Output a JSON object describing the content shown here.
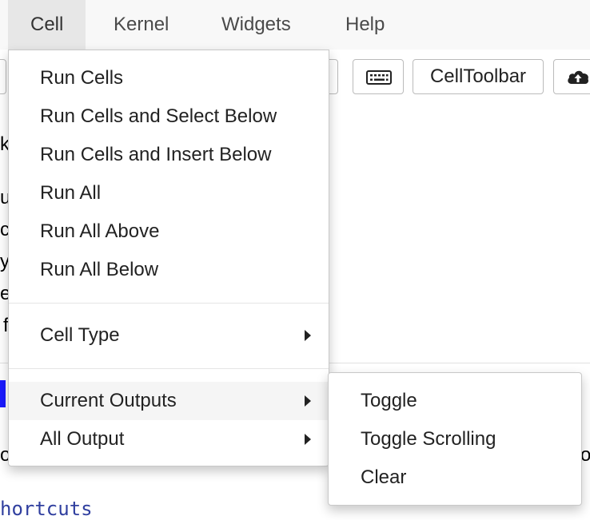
{
  "menubar": {
    "items": [
      {
        "label": "Cell",
        "open": true
      },
      {
        "label": "Kernel"
      },
      {
        "label": "Widgets"
      },
      {
        "label": "Help"
      }
    ]
  },
  "toolbar": {
    "keyboard_icon": "keyboard-icon",
    "celltoolbar_label": "CellToolbar",
    "upload_icon": "cloud-upload-icon"
  },
  "cell_menu": {
    "group1": [
      "Run Cells",
      "Run Cells and Select Below",
      "Run Cells and Insert Below",
      "Run All",
      "Run All Above",
      "Run All Below"
    ],
    "cell_type": "Cell Type",
    "current_outputs": "Current Outputs",
    "all_output": "All Output"
  },
  "submenu": {
    "items": [
      "Toggle",
      "Toggle Scrolling",
      "Clear"
    ]
  },
  "background": {
    "fragments": [
      "k",
      "u",
      "c",
      "y",
      "e",
      "f",
      "o",
      "o"
    ],
    "link_fragment": "hortcuts"
  },
  "colors": {
    "menubar_bg": "#f8f8f8",
    "open_menu_bg": "#e7e7e7",
    "highlight_bg": "#f5f5f5",
    "link": "#303f9f",
    "cell_marker": "#1a1aff"
  }
}
